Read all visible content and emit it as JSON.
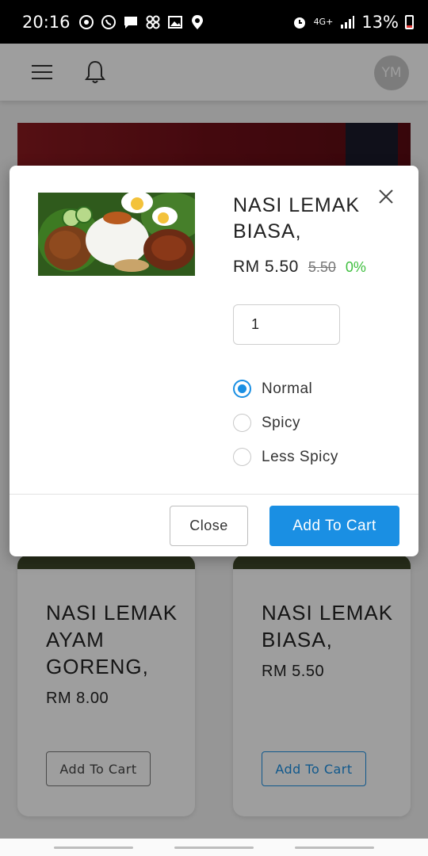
{
  "status_bar": {
    "time": "20:16",
    "network": "4G+",
    "battery": "13%"
  },
  "header": {
    "avatar_initials": "YM"
  },
  "products": [
    {
      "name": "NASI LEMAK AYAM GORENG,",
      "price": "RM 8.00",
      "button_label": "Add To Cart"
    },
    {
      "name": "NASI LEMAK BIASA,",
      "price": "RM 5.50",
      "button_label": "Add To Cart"
    }
  ],
  "modal": {
    "title": "NASI LEMAK BIASA,",
    "price": "RM 5.50",
    "original_price": "5.50",
    "discount": "0%",
    "quantity": "1",
    "spice_options": [
      {
        "label": "Normal",
        "selected": true
      },
      {
        "label": "Spicy",
        "selected": false
      },
      {
        "label": "Less Spicy",
        "selected": false
      }
    ],
    "close_label": "Close",
    "add_to_cart_label": "Add To Cart"
  },
  "colors": {
    "accent": "#1a8fe3",
    "discount_green": "#3fbf3f"
  }
}
